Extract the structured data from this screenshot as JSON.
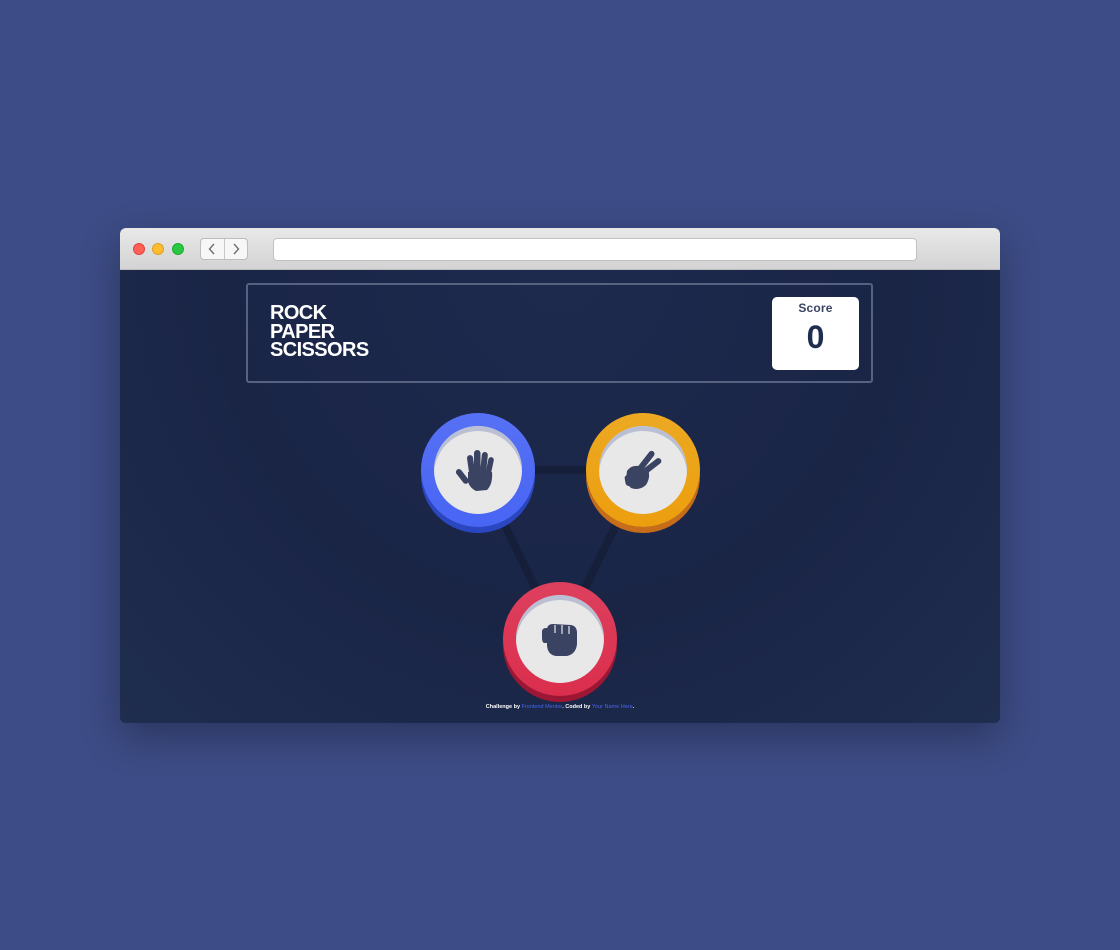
{
  "game": {
    "title_lines": [
      "ROCK",
      "PAPER",
      "SCISSORS"
    ],
    "score_label": "Score",
    "score_value": "0"
  },
  "choices": [
    {
      "id": "paper",
      "icon": "hand-paper-icon",
      "color": "#4865f4"
    },
    {
      "id": "scissors",
      "icon": "hand-scissors-icon",
      "color": "#ec9e0e"
    },
    {
      "id": "rock",
      "icon": "hand-rock-icon",
      "color": "#db2e4d"
    }
  ],
  "footer": {
    "challenge_prefix": "Challenge by",
    "challenge_link": "Frontend Mentor",
    "coded_prefix": ". Coded by",
    "coded_link": "Your Name Here",
    "suffix": "."
  },
  "colors": {
    "page_background": "#3d4c86",
    "game_background": "#1c2a4b",
    "header_outline": "#56627f",
    "icon_color": "#3b4363"
  }
}
